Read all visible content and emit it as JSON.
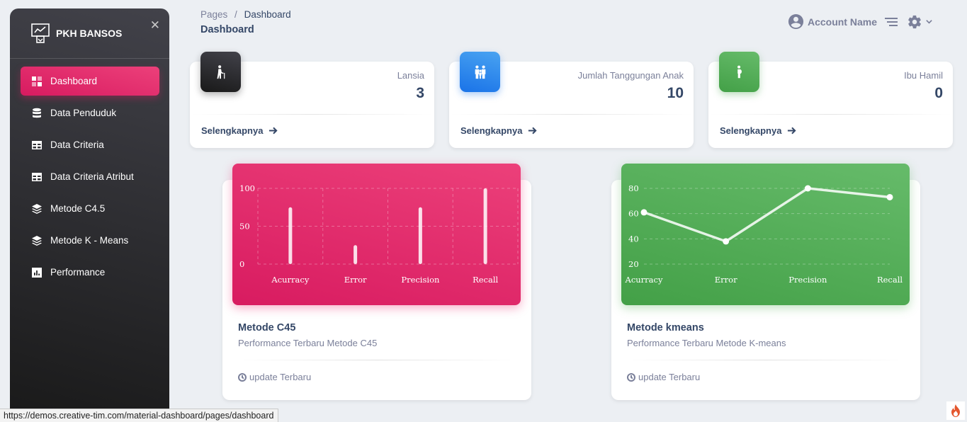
{
  "sidebar": {
    "brand": "PKH BANSOS",
    "items": [
      {
        "label": "Dashboard",
        "icon": "dashboard-icon"
      },
      {
        "label": "Data Penduduk",
        "icon": "database-icon"
      },
      {
        "label": "Data Criteria",
        "icon": "table-icon"
      },
      {
        "label": "Data Criteria Atribut",
        "icon": "table-icon"
      },
      {
        "label": "Metode C4.5",
        "icon": "layers-icon"
      },
      {
        "label": "Metode K - Means",
        "icon": "layers-icon"
      },
      {
        "label": "Performance",
        "icon": "bar-chart-icon"
      }
    ]
  },
  "header": {
    "breadcrumb_root": "Pages",
    "breadcrumb_sep": "/",
    "breadcrumb_current": "Dashboard",
    "title": "Dashboard",
    "account": "Account Name"
  },
  "stats": [
    {
      "label": "Lansia",
      "value": "3",
      "link": "Selengkapnya",
      "color": "#262626",
      "icon": "elderly-icon"
    },
    {
      "label": "Jumlah Tanggungan Anak",
      "value": "10",
      "link": "Selengkapnya",
      "color": "#1a73e8",
      "icon": "family-icon"
    },
    {
      "label": "Ibu Hamil",
      "value": "0",
      "link": "Selengkapnya",
      "color": "#43a047",
      "icon": "pregnant-icon"
    }
  ],
  "charts": [
    {
      "title": "Metode C45",
      "subtitle": "Performance Terbaru Metode C45",
      "footer": "update Terbaru"
    },
    {
      "title": "Metode kmeans",
      "subtitle": "Performance Terbaru Metode K-means",
      "footer": "update Terbaru"
    }
  ],
  "chart_data": [
    {
      "type": "bar",
      "categories": [
        "Acurracy",
        "Error",
        "Precision",
        "Recall"
      ],
      "values": [
        75,
        25,
        75,
        100
      ],
      "yticks": [
        "100",
        "50",
        "0"
      ],
      "ylim": [
        0,
        100
      ],
      "grid": true,
      "color": "#e91e63"
    },
    {
      "type": "line",
      "categories": [
        "Acurracy",
        "Error",
        "Precision",
        "Recall"
      ],
      "values": [
        61,
        38,
        80,
        73
      ],
      "yticks": [
        "80",
        "60",
        "40",
        "20"
      ],
      "ylim": [
        20,
        80
      ],
      "grid": true,
      "color": "#4caf50"
    }
  ],
  "status_url": "https://demos.creative-tim.com/material-dashboard/pages/dashboard"
}
